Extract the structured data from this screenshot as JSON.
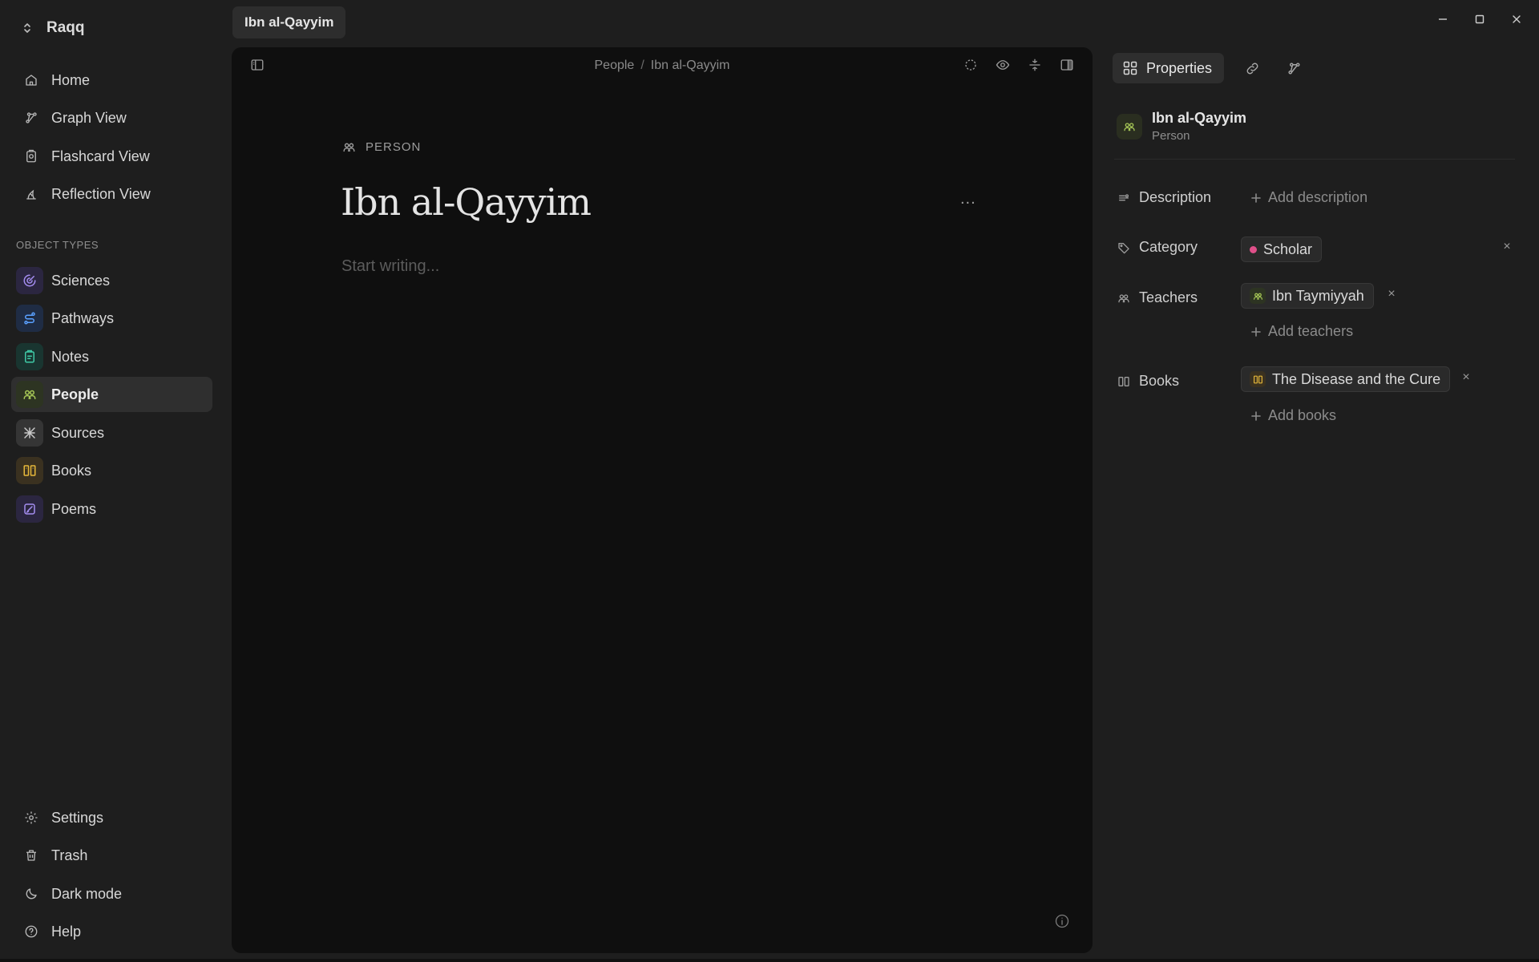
{
  "app": {
    "name": "Raqq",
    "tab_title": "Ibn al-Qayyim"
  },
  "sidebar": {
    "nav": [
      {
        "label": "Home",
        "icon": "home-icon"
      },
      {
        "label": "Graph View",
        "icon": "graph-icon"
      },
      {
        "label": "Flashcard View",
        "icon": "flashcard-icon"
      },
      {
        "label": "Reflection View",
        "icon": "reflection-icon"
      }
    ],
    "section_label": "OBJECT TYPES",
    "types": [
      {
        "label": "Sciences",
        "icon": "sciences-icon",
        "color": "#a48df0",
        "bg": "#2b2640"
      },
      {
        "label": "Pathways",
        "icon": "pathways-icon",
        "color": "#5aa0ff",
        "bg": "#1f2c44"
      },
      {
        "label": "Notes",
        "icon": "notes-icon",
        "color": "#3fc9a6",
        "bg": "#193530"
      },
      {
        "label": "People",
        "icon": "people-icon",
        "color": "#a7c857",
        "bg": "#2d3422",
        "active": true
      },
      {
        "label": "Sources",
        "icon": "sources-icon",
        "color": "#c8c8c8",
        "bg": "#353535"
      },
      {
        "label": "Books",
        "icon": "books-icon",
        "color": "#e6b83a",
        "bg": "#3a3120"
      },
      {
        "label": "Poems",
        "icon": "poems-icon",
        "color": "#a48df0",
        "bg": "#2b2640"
      }
    ],
    "footer": [
      {
        "label": "Settings",
        "icon": "gear-icon"
      },
      {
        "label": "Trash",
        "icon": "trash-icon"
      },
      {
        "label": "Dark mode",
        "icon": "moon-icon"
      },
      {
        "label": "Help",
        "icon": "help-icon"
      }
    ]
  },
  "editor": {
    "breadcrumb": [
      "People",
      "Ibn al-Qayyim"
    ],
    "type_label": "PERSON",
    "title": "Ibn al-Qayyim",
    "more": "...",
    "placeholder": "Start writing..."
  },
  "properties": {
    "tab_label": "Properties",
    "object": {
      "name": "Ibn al-Qayyim",
      "kind": "Person"
    },
    "description": {
      "label": "Description",
      "add_label": "Add description"
    },
    "category": {
      "label": "Category",
      "value": "Scholar",
      "dot_color": "#e0508a"
    },
    "teachers": {
      "label": "Teachers",
      "items": [
        "Ibn Taymiyyah"
      ],
      "add_label": "Add teachers"
    },
    "books": {
      "label": "Books",
      "items": [
        "The Disease and the Cure"
      ],
      "add_label": "Add books"
    },
    "remove": "×"
  }
}
